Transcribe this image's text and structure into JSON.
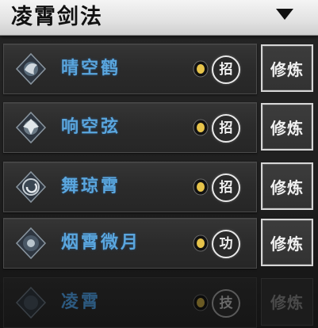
{
  "header": {
    "title": "凌霄剑法"
  },
  "skills": [
    {
      "name": "晴空鹤",
      "badge": "招",
      "button": "修炼",
      "enabled": true
    },
    {
      "name": "响空弦",
      "badge": "招",
      "button": "修炼",
      "enabled": true
    },
    {
      "name": "舞琼霄",
      "badge": "招",
      "button": "修炼",
      "enabled": true
    },
    {
      "name": "烟霄微月",
      "badge": "功",
      "button": "修炼",
      "enabled": true
    },
    {
      "name": "凌霄",
      "badge": "技",
      "button": "修炼",
      "enabled": false
    }
  ],
  "icons": {
    "dropdown": "triangle-down-icon",
    "coin": "gold-coin-icon",
    "skill": "skill-emblem-icon"
  },
  "colors": {
    "skill_name": "#5aa6de",
    "coin": "#e6c34a",
    "header_bg": "#e8e8e8"
  }
}
